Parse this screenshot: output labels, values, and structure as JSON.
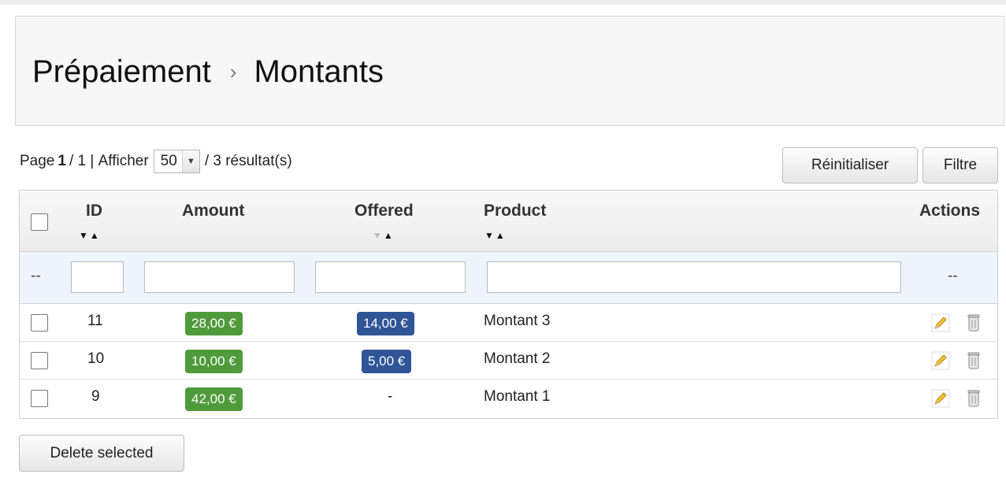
{
  "breadcrumb": {
    "parent": "Prépaiement",
    "separator": "›",
    "current": "Montants"
  },
  "pager": {
    "page_label": "Page",
    "current_page": "1",
    "total_pages": "1",
    "show_label": "Afficher",
    "per_page": "50",
    "results_text": "/ 3 résultat(s)"
  },
  "toolbar": {
    "reset_label": "Réinitialiser",
    "filter_label": "Filtre",
    "delete_selected_label": "Delete selected"
  },
  "table": {
    "columns": {
      "id": "ID",
      "amount": "Amount",
      "offered": "Offered",
      "product": "Product",
      "actions": "Actions"
    },
    "filter_placeholder_dash": "--",
    "rows": [
      {
        "id": "11",
        "amount": "28,00 €",
        "offered": "14,00 €",
        "product": "Montant 3"
      },
      {
        "id": "10",
        "amount": "10,00 €",
        "offered": "5,00 €",
        "product": "Montant 2"
      },
      {
        "id": "9",
        "amount": "42,00 €",
        "offered": "-",
        "product": "Montant 1"
      }
    ]
  },
  "colors": {
    "amount_badge": "#4f9a3a",
    "offered_badge": "#2f5597"
  },
  "icons": {
    "edit": "pencil-icon",
    "delete": "trash-icon",
    "sort_desc": "sort-desc-icon",
    "sort_asc": "sort-asc-icon"
  }
}
